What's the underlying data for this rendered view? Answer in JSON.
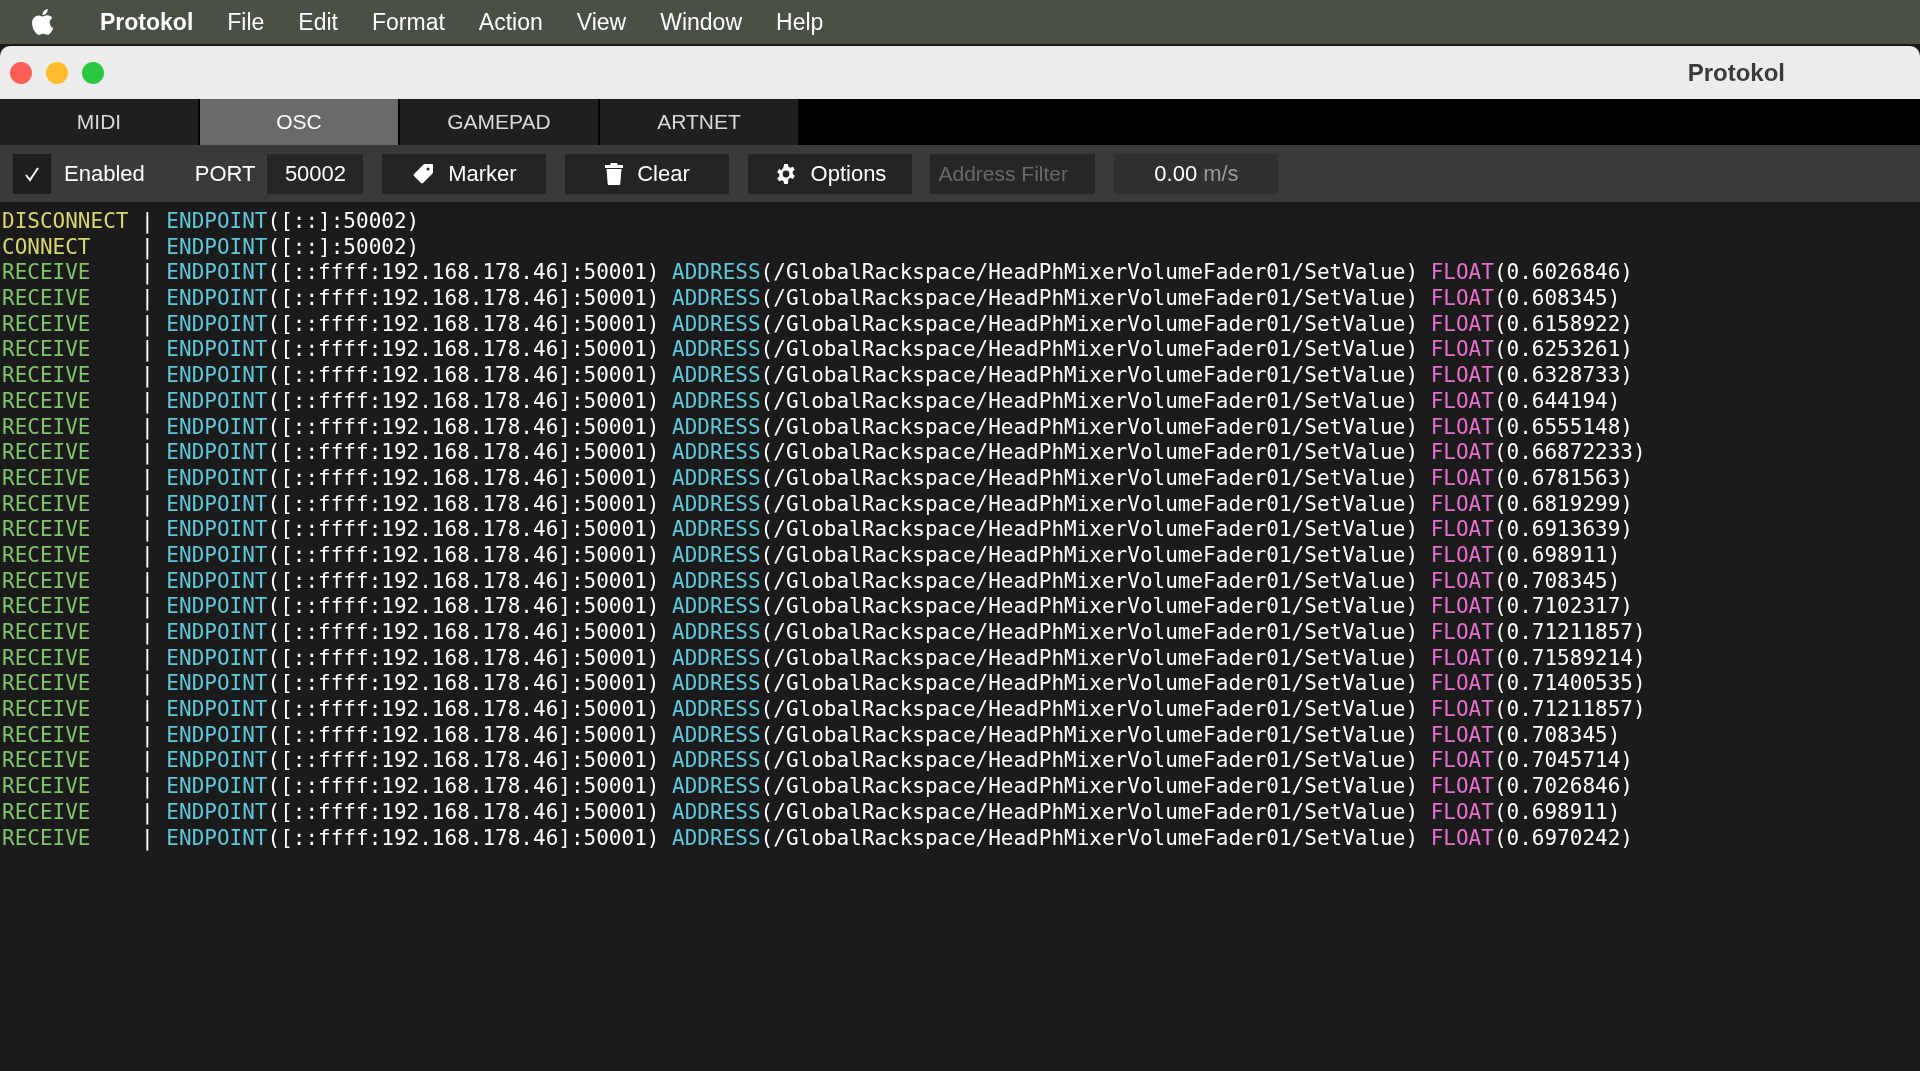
{
  "menu_bar": {
    "app_name": "Protokol",
    "items": [
      "File",
      "Edit",
      "Format",
      "Action",
      "View",
      "Window",
      "Help"
    ]
  },
  "window": {
    "title": "Protokol"
  },
  "tabs": [
    {
      "label": "MIDI",
      "selected": false
    },
    {
      "label": "OSC",
      "selected": true
    },
    {
      "label": "GAMEPAD",
      "selected": false
    },
    {
      "label": "ARTNET",
      "selected": false
    }
  ],
  "toolbar": {
    "enabled": {
      "label": "Enabled",
      "checked": true
    },
    "port": {
      "label": "PORT",
      "value": "50002"
    },
    "buttons": [
      {
        "kind": "marker",
        "label": "Marker"
      },
      {
        "kind": "clear",
        "label": "Clear"
      },
      {
        "kind": "options",
        "label": "Options"
      }
    ],
    "address_filter": {
      "placeholder": "Address Filter"
    },
    "rate": {
      "value": "0.00",
      "unit": "m/s"
    }
  },
  "log": [
    {
      "kind": "disconnect",
      "event": "DISCONNECT",
      "separator": "|",
      "fields": [
        {
          "kind": "endpoint",
          "label": "ENDPOINT",
          "value": "([::]:50002)"
        }
      ]
    },
    {
      "kind": "connect",
      "event": "CONNECT",
      "separator": "|",
      "fields": [
        {
          "kind": "endpoint",
          "label": "ENDPOINT",
          "value": "([::]:50002)"
        }
      ]
    },
    {
      "kind": "receive",
      "event": "RECEIVE",
      "separator": "|",
      "fields": [
        {
          "kind": "endpoint",
          "label": "ENDPOINT",
          "value": "([::ffff:192.168.178.46]:50001)"
        },
        {
          "kind": "address",
          "label": "ADDRESS",
          "value": "(/GlobalRackspace/HeadPhMixerVolumeFader01/SetValue)"
        },
        {
          "kind": "float",
          "label": "FLOAT",
          "value": "(0.6026846)"
        }
      ]
    },
    {
      "kind": "receive",
      "event": "RECEIVE",
      "separator": "|",
      "fields": [
        {
          "kind": "endpoint",
          "label": "ENDPOINT",
          "value": "([::ffff:192.168.178.46]:50001)"
        },
        {
          "kind": "address",
          "label": "ADDRESS",
          "value": "(/GlobalRackspace/HeadPhMixerVolumeFader01/SetValue)"
        },
        {
          "kind": "float",
          "label": "FLOAT",
          "value": "(0.608345)"
        }
      ]
    },
    {
      "kind": "receive",
      "event": "RECEIVE",
      "separator": "|",
      "fields": [
        {
          "kind": "endpoint",
          "label": "ENDPOINT",
          "value": "([::ffff:192.168.178.46]:50001)"
        },
        {
          "kind": "address",
          "label": "ADDRESS",
          "value": "(/GlobalRackspace/HeadPhMixerVolumeFader01/SetValue)"
        },
        {
          "kind": "float",
          "label": "FLOAT",
          "value": "(0.6158922)"
        }
      ]
    },
    {
      "kind": "receive",
      "event": "RECEIVE",
      "separator": "|",
      "fields": [
        {
          "kind": "endpoint",
          "label": "ENDPOINT",
          "value": "([::ffff:192.168.178.46]:50001)"
        },
        {
          "kind": "address",
          "label": "ADDRESS",
          "value": "(/GlobalRackspace/HeadPhMixerVolumeFader01/SetValue)"
        },
        {
          "kind": "float",
          "label": "FLOAT",
          "value": "(0.6253261)"
        }
      ]
    },
    {
      "kind": "receive",
      "event": "RECEIVE",
      "separator": "|",
      "fields": [
        {
          "kind": "endpoint",
          "label": "ENDPOINT",
          "value": "([::ffff:192.168.178.46]:50001)"
        },
        {
          "kind": "address",
          "label": "ADDRESS",
          "value": "(/GlobalRackspace/HeadPhMixerVolumeFader01/SetValue)"
        },
        {
          "kind": "float",
          "label": "FLOAT",
          "value": "(0.6328733)"
        }
      ]
    },
    {
      "kind": "receive",
      "event": "RECEIVE",
      "separator": "|",
      "fields": [
        {
          "kind": "endpoint",
          "label": "ENDPOINT",
          "value": "([::ffff:192.168.178.46]:50001)"
        },
        {
          "kind": "address",
          "label": "ADDRESS",
          "value": "(/GlobalRackspace/HeadPhMixerVolumeFader01/SetValue)"
        },
        {
          "kind": "float",
          "label": "FLOAT",
          "value": "(0.644194)"
        }
      ]
    },
    {
      "kind": "receive",
      "event": "RECEIVE",
      "separator": "|",
      "fields": [
        {
          "kind": "endpoint",
          "label": "ENDPOINT",
          "value": "([::ffff:192.168.178.46]:50001)"
        },
        {
          "kind": "address",
          "label": "ADDRESS",
          "value": "(/GlobalRackspace/HeadPhMixerVolumeFader01/SetValue)"
        },
        {
          "kind": "float",
          "label": "FLOAT",
          "value": "(0.6555148)"
        }
      ]
    },
    {
      "kind": "receive",
      "event": "RECEIVE",
      "separator": "|",
      "fields": [
        {
          "kind": "endpoint",
          "label": "ENDPOINT",
          "value": "([::ffff:192.168.178.46]:50001)"
        },
        {
          "kind": "address",
          "label": "ADDRESS",
          "value": "(/GlobalRackspace/HeadPhMixerVolumeFader01/SetValue)"
        },
        {
          "kind": "float",
          "label": "FLOAT",
          "value": "(0.66872233)"
        }
      ]
    },
    {
      "kind": "receive",
      "event": "RECEIVE",
      "separator": "|",
      "fields": [
        {
          "kind": "endpoint",
          "label": "ENDPOINT",
          "value": "([::ffff:192.168.178.46]:50001)"
        },
        {
          "kind": "address",
          "label": "ADDRESS",
          "value": "(/GlobalRackspace/HeadPhMixerVolumeFader01/SetValue)"
        },
        {
          "kind": "float",
          "label": "FLOAT",
          "value": "(0.6781563)"
        }
      ]
    },
    {
      "kind": "receive",
      "event": "RECEIVE",
      "separator": "|",
      "fields": [
        {
          "kind": "endpoint",
          "label": "ENDPOINT",
          "value": "([::ffff:192.168.178.46]:50001)"
        },
        {
          "kind": "address",
          "label": "ADDRESS",
          "value": "(/GlobalRackspace/HeadPhMixerVolumeFader01/SetValue)"
        },
        {
          "kind": "float",
          "label": "FLOAT",
          "value": "(0.6819299)"
        }
      ]
    },
    {
      "kind": "receive",
      "event": "RECEIVE",
      "separator": "|",
      "fields": [
        {
          "kind": "endpoint",
          "label": "ENDPOINT",
          "value": "([::ffff:192.168.178.46]:50001)"
        },
        {
          "kind": "address",
          "label": "ADDRESS",
          "value": "(/GlobalRackspace/HeadPhMixerVolumeFader01/SetValue)"
        },
        {
          "kind": "float",
          "label": "FLOAT",
          "value": "(0.6913639)"
        }
      ]
    },
    {
      "kind": "receive",
      "event": "RECEIVE",
      "separator": "|",
      "fields": [
        {
          "kind": "endpoint",
          "label": "ENDPOINT",
          "value": "([::ffff:192.168.178.46]:50001)"
        },
        {
          "kind": "address",
          "label": "ADDRESS",
          "value": "(/GlobalRackspace/HeadPhMixerVolumeFader01/SetValue)"
        },
        {
          "kind": "float",
          "label": "FLOAT",
          "value": "(0.698911)"
        }
      ]
    },
    {
      "kind": "receive",
      "event": "RECEIVE",
      "separator": "|",
      "fields": [
        {
          "kind": "endpoint",
          "label": "ENDPOINT",
          "value": "([::ffff:192.168.178.46]:50001)"
        },
        {
          "kind": "address",
          "label": "ADDRESS",
          "value": "(/GlobalRackspace/HeadPhMixerVolumeFader01/SetValue)"
        },
        {
          "kind": "float",
          "label": "FLOAT",
          "value": "(0.708345)"
        }
      ]
    },
    {
      "kind": "receive",
      "event": "RECEIVE",
      "separator": "|",
      "fields": [
        {
          "kind": "endpoint",
          "label": "ENDPOINT",
          "value": "([::ffff:192.168.178.46]:50001)"
        },
        {
          "kind": "address",
          "label": "ADDRESS",
          "value": "(/GlobalRackspace/HeadPhMixerVolumeFader01/SetValue)"
        },
        {
          "kind": "float",
          "label": "FLOAT",
          "value": "(0.7102317)"
        }
      ]
    },
    {
      "kind": "receive",
      "event": "RECEIVE",
      "separator": "|",
      "fields": [
        {
          "kind": "endpoint",
          "label": "ENDPOINT",
          "value": "([::ffff:192.168.178.46]:50001)"
        },
        {
          "kind": "address",
          "label": "ADDRESS",
          "value": "(/GlobalRackspace/HeadPhMixerVolumeFader01/SetValue)"
        },
        {
          "kind": "float",
          "label": "FLOAT",
          "value": "(0.71211857)"
        }
      ]
    },
    {
      "kind": "receive",
      "event": "RECEIVE",
      "separator": "|",
      "fields": [
        {
          "kind": "endpoint",
          "label": "ENDPOINT",
          "value": "([::ffff:192.168.178.46]:50001)"
        },
        {
          "kind": "address",
          "label": "ADDRESS",
          "value": "(/GlobalRackspace/HeadPhMixerVolumeFader01/SetValue)"
        },
        {
          "kind": "float",
          "label": "FLOAT",
          "value": "(0.71589214)"
        }
      ]
    },
    {
      "kind": "receive",
      "event": "RECEIVE",
      "separator": "|",
      "fields": [
        {
          "kind": "endpoint",
          "label": "ENDPOINT",
          "value": "([::ffff:192.168.178.46]:50001)"
        },
        {
          "kind": "address",
          "label": "ADDRESS",
          "value": "(/GlobalRackspace/HeadPhMixerVolumeFader01/SetValue)"
        },
        {
          "kind": "float",
          "label": "FLOAT",
          "value": "(0.71400535)"
        }
      ]
    },
    {
      "kind": "receive",
      "event": "RECEIVE",
      "separator": "|",
      "fields": [
        {
          "kind": "endpoint",
          "label": "ENDPOINT",
          "value": "([::ffff:192.168.178.46]:50001)"
        },
        {
          "kind": "address",
          "label": "ADDRESS",
          "value": "(/GlobalRackspace/HeadPhMixerVolumeFader01/SetValue)"
        },
        {
          "kind": "float",
          "label": "FLOAT",
          "value": "(0.71211857)"
        }
      ]
    },
    {
      "kind": "receive",
      "event": "RECEIVE",
      "separator": "|",
      "fields": [
        {
          "kind": "endpoint",
          "label": "ENDPOINT",
          "value": "([::ffff:192.168.178.46]:50001)"
        },
        {
          "kind": "address",
          "label": "ADDRESS",
          "value": "(/GlobalRackspace/HeadPhMixerVolumeFader01/SetValue)"
        },
        {
          "kind": "float",
          "label": "FLOAT",
          "value": "(0.708345)"
        }
      ]
    },
    {
      "kind": "receive",
      "event": "RECEIVE",
      "separator": "|",
      "fields": [
        {
          "kind": "endpoint",
          "label": "ENDPOINT",
          "value": "([::ffff:192.168.178.46]:50001)"
        },
        {
          "kind": "address",
          "label": "ADDRESS",
          "value": "(/GlobalRackspace/HeadPhMixerVolumeFader01/SetValue)"
        },
        {
          "kind": "float",
          "label": "FLOAT",
          "value": "(0.7045714)"
        }
      ]
    },
    {
      "kind": "receive",
      "event": "RECEIVE",
      "separator": "|",
      "fields": [
        {
          "kind": "endpoint",
          "label": "ENDPOINT",
          "value": "([::ffff:192.168.178.46]:50001)"
        },
        {
          "kind": "address",
          "label": "ADDRESS",
          "value": "(/GlobalRackspace/HeadPhMixerVolumeFader01/SetValue)"
        },
        {
          "kind": "float",
          "label": "FLOAT",
          "value": "(0.7026846)"
        }
      ]
    },
    {
      "kind": "receive",
      "event": "RECEIVE",
      "separator": "|",
      "fields": [
        {
          "kind": "endpoint",
          "label": "ENDPOINT",
          "value": "([::ffff:192.168.178.46]:50001)"
        },
        {
          "kind": "address",
          "label": "ADDRESS",
          "value": "(/GlobalRackspace/HeadPhMixerVolumeFader01/SetValue)"
        },
        {
          "kind": "float",
          "label": "FLOAT",
          "value": "(0.698911)"
        }
      ]
    },
    {
      "kind": "receive",
      "event": "RECEIVE",
      "separator": "|",
      "fields": [
        {
          "kind": "endpoint",
          "label": "ENDPOINT",
          "value": "([::ffff:192.168.178.46]:50001)"
        },
        {
          "kind": "address",
          "label": "ADDRESS",
          "value": "(/GlobalRackspace/HeadPhMixerVolumeFader01/SetValue)"
        },
        {
          "kind": "float",
          "label": "FLOAT",
          "value": "(0.6970242)"
        }
      ]
    }
  ]
}
